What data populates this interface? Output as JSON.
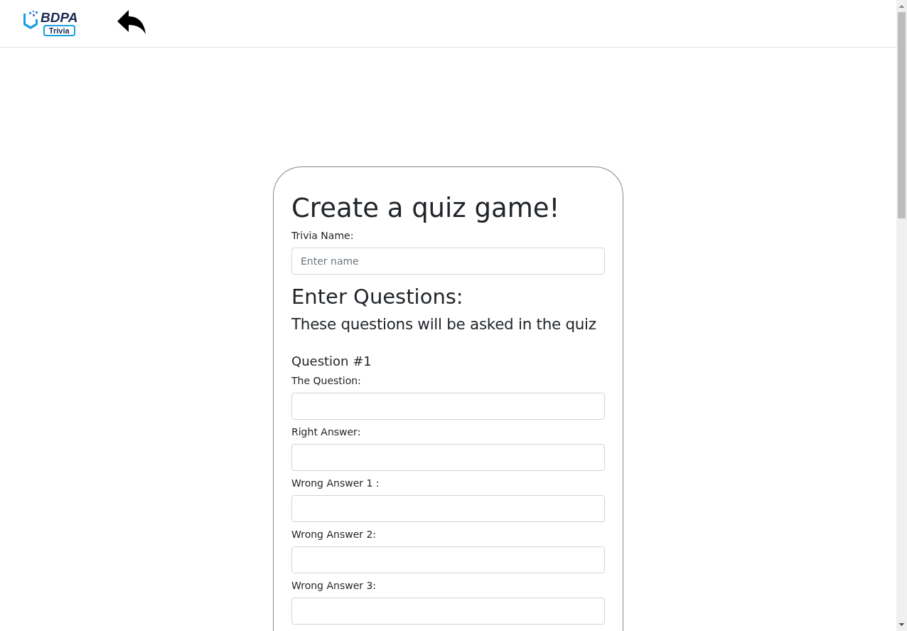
{
  "header": {
    "logo": {
      "brand": "BDPA",
      "tag": "Trivia"
    }
  },
  "form": {
    "title": "Create a quiz game!",
    "name_field": {
      "label": "Trivia Name:",
      "placeholder": "Enter name"
    },
    "section_title": "Enter Questions:",
    "section_subtitle": "These questions will be asked in the quiz",
    "questions": [
      {
        "heading": "Question #1",
        "fields": [
          {
            "label": "The Question:"
          },
          {
            "label": "Right Answer:"
          },
          {
            "label": "Wrong Answer 1 :"
          },
          {
            "label": "Wrong Answer 2:"
          },
          {
            "label": "Wrong Answer 3:"
          }
        ]
      }
    ]
  }
}
